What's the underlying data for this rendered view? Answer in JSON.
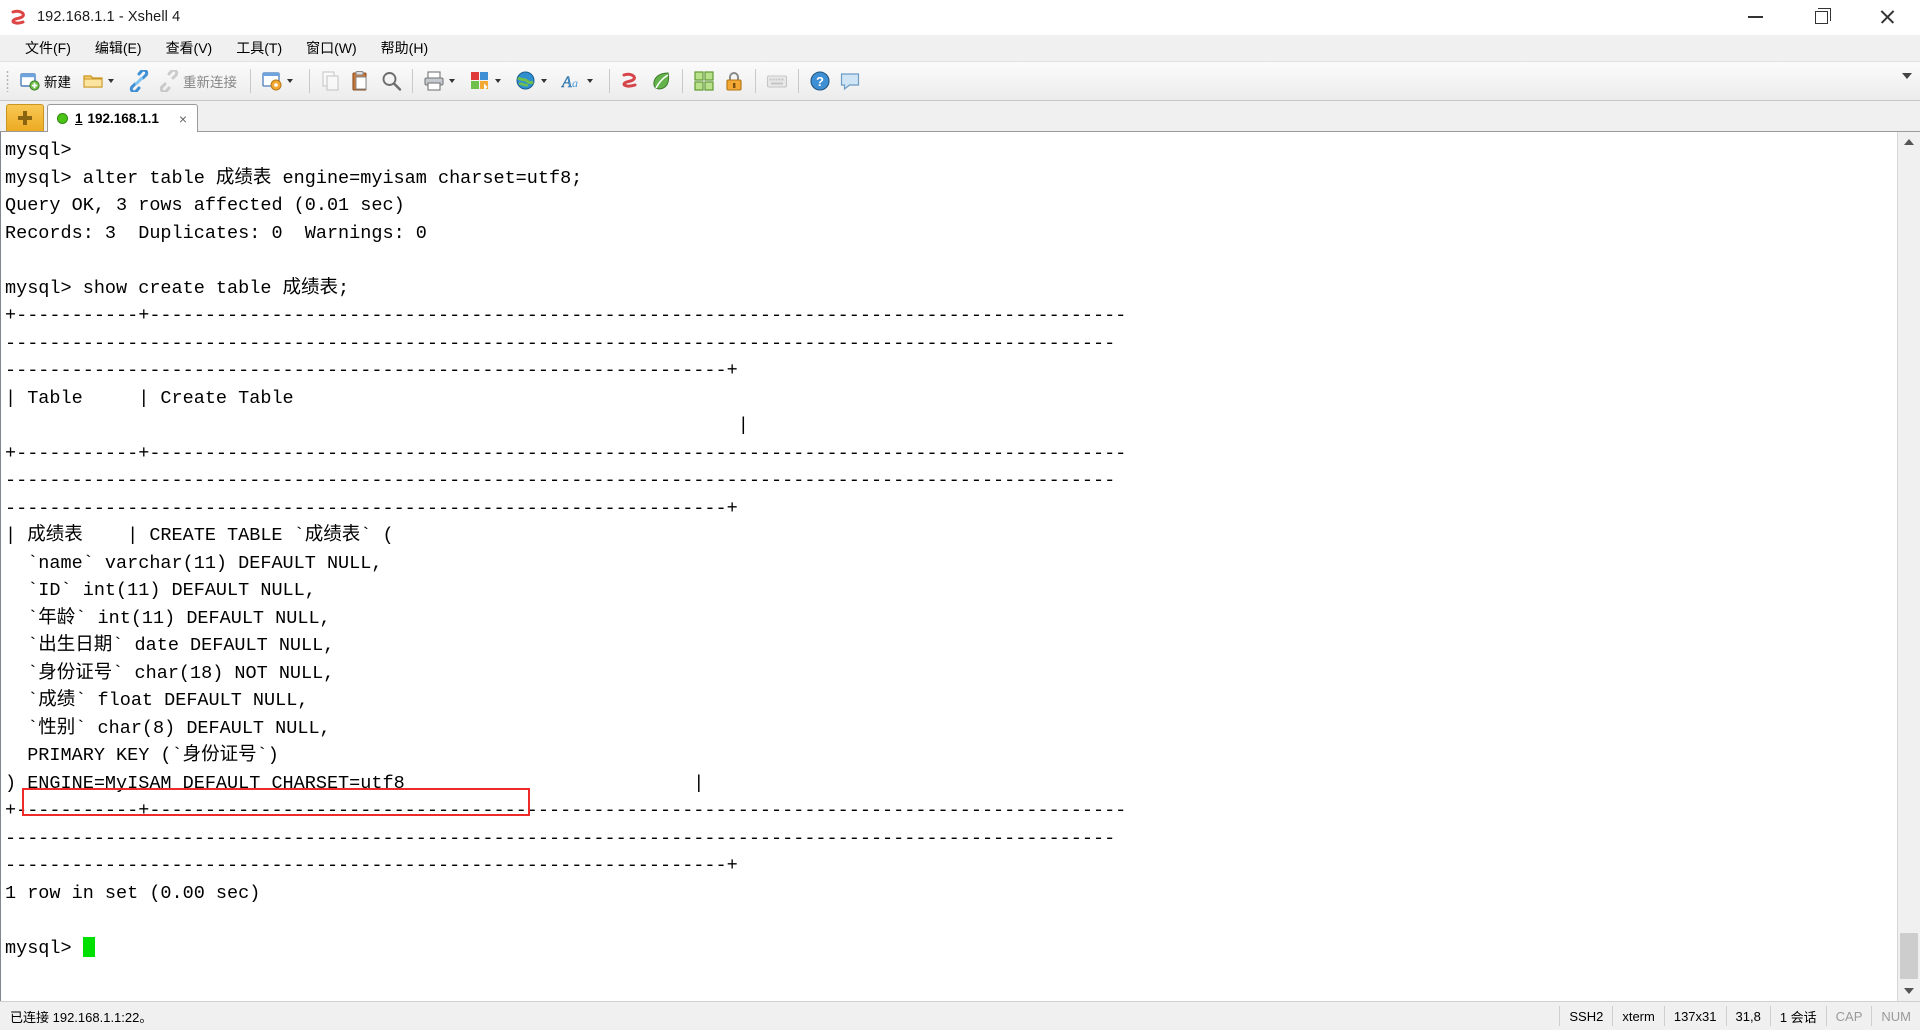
{
  "window": {
    "title": "192.168.1.1 - Xshell 4",
    "app_icon": "xshell-logo-icon",
    "controls": {
      "minimize": "minimize",
      "maximize": "maximize",
      "close": "close"
    }
  },
  "menubar": {
    "items": [
      {
        "label": "文件(F)",
        "name": "menu-file"
      },
      {
        "label": "编辑(E)",
        "name": "menu-edit"
      },
      {
        "label": "查看(V)",
        "name": "menu-view"
      },
      {
        "label": "工具(T)",
        "name": "menu-tools"
      },
      {
        "label": "窗口(W)",
        "name": "menu-window"
      },
      {
        "label": "帮助(H)",
        "name": "menu-help"
      }
    ]
  },
  "toolbar": {
    "new_label": "新建",
    "reconnect_label": "重新连接",
    "overflow": "toolbar-overflow-chevron"
  },
  "tabbar": {
    "new_tab_label": "+",
    "tab": {
      "index": "1",
      "title": "192.168.1.1",
      "close_label": "×",
      "status_color": "#4cc417"
    }
  },
  "terminal": {
    "highlight_color": "#ee2b2b",
    "cursor_color": "#00e000",
    "lines": [
      "mysql>",
      "mysql> alter table 成绩表 engine=myisam charset=utf8;",
      "Query OK, 3 rows affected (0.01 sec)",
      "Records: 3  Duplicates: 0  Warnings: 0",
      "",
      "mysql> show create table 成绩表;",
      "+-----------+----------------------------------------------------------------------------------------",
      "----------------------------------------------------------------------------------------------------",
      "-----------------------------------------------------------------+",
      "| Table     | Create Table",
      "                                                                  |",
      "+-----------+----------------------------------------------------------------------------------------",
      "----------------------------------------------------------------------------------------------------",
      "-----------------------------------------------------------------+",
      "| 成绩表    | CREATE TABLE `成绩表` (",
      "  `name` varchar(11) DEFAULT NULL,",
      "  `ID` int(11) DEFAULT NULL,",
      "  `年龄` int(11) DEFAULT NULL,",
      "  `出生日期` date DEFAULT NULL,",
      "  `身份证号` char(18) NOT NULL,",
      "  `成绩` float DEFAULT NULL,",
      "  `性别` char(8) DEFAULT NULL,",
      "  PRIMARY KEY (`身份证号`)",
      ") ENGINE=MyISAM DEFAULT CHARSET=utf8                          |",
      "+-----------+----------------------------------------------------------------------------------------",
      "----------------------------------------------------------------------------------------------------",
      "-----------------------------------------------------------------+",
      "1 row in set (0.00 sec)",
      "",
      "mysql> "
    ],
    "highlighted_text": "ENGINE=MyISAM DEFAULT CHARSET=utf8"
  },
  "statusbar": {
    "connection": "已连接 192.168.1.1:22。",
    "protocol": "SSH2",
    "terminal_type": "xterm",
    "size": "137x31",
    "cursor_pos": "31,8",
    "sessions": "1 会话",
    "cap": "CAP",
    "num": "NUM"
  }
}
